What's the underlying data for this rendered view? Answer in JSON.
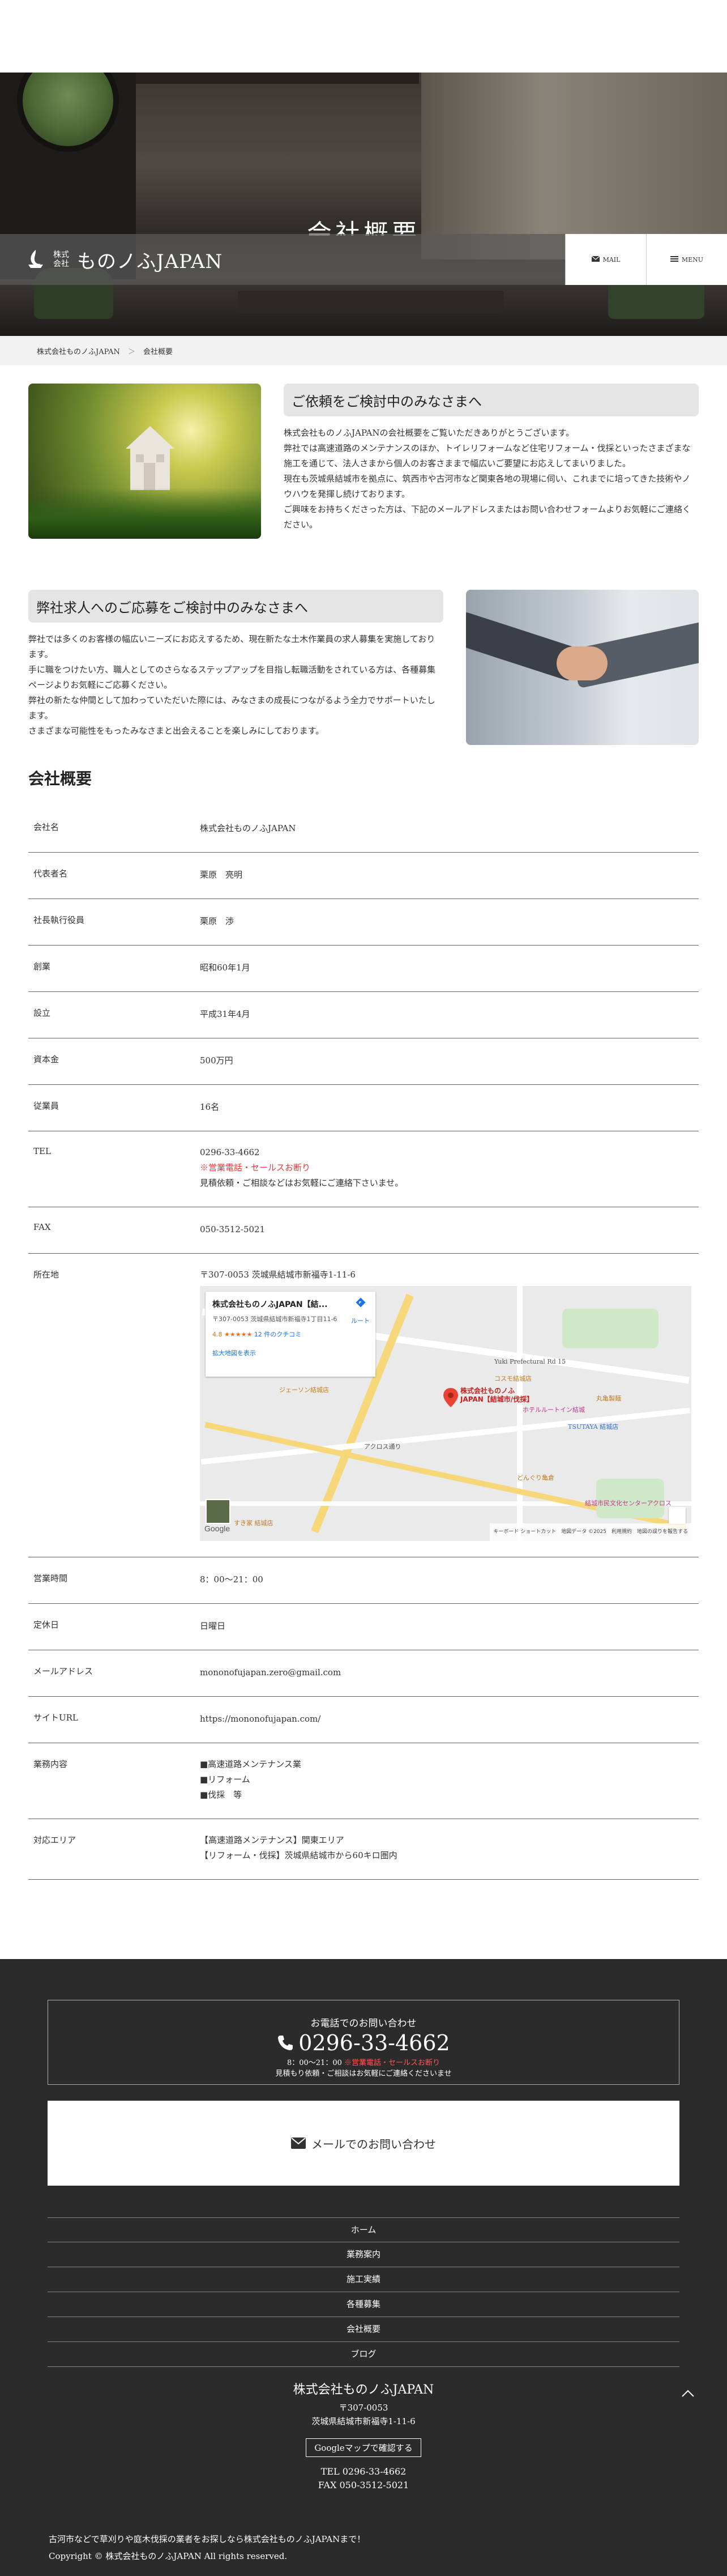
{
  "hero": {
    "title": "会社概要"
  },
  "header": {
    "logo_sub_1": "株式",
    "logo_sub_2": "会社",
    "logo_name": "ものノふJAPAN",
    "mail_label": "MAIL",
    "menu_label": "MENU"
  },
  "breadcrumb": {
    "home": "株式会社ものノふJAPAN",
    "sep": "＞",
    "current": "会社概要"
  },
  "intro1": {
    "title": "ご依頼をご検討中のみなさまへ",
    "lines": [
      "株式会社ものノふJAPANの会社概要をご覧いただきありがとうございます。",
      "弊社では高速道路のメンテナンスのほか、トイレリフォームなど住宅リフォーム・伐採といったさまざまな施工を通じて、法人さまから個人のお客さままで幅広いご要望にお応えしてまいりました。",
      "現在も茨城県結城市を拠点に、筑西市や古河市など関東各地の現場に伺い、これまでに培ってきた技術やノウハウを発揮し続けております。",
      "ご興味をお持ちくださった方は、下記のメールアドレスまたはお問い合わせフォームよりお気軽にご連絡ください。"
    ]
  },
  "intro2": {
    "title": "弊社求人へのご応募をご検討中のみなさまへ",
    "lines": [
      "弊社では多くのお客様の幅広いニーズにお応えするため、現在新たな土木作業員の求人募集を実施しております。",
      "手に職をつけたい方、職人としてのさらなるステップアップを目指し転職活動をされている方は、各種募集ページよりお気軽にご応募ください。",
      "弊社の新たな仲間として加わっていただいた際には、みなさまの成長につながるよう全力でサポートいたします。",
      "さまざまな可能性をもったみなさまと出会えることを楽しみにしております。"
    ]
  },
  "outline": {
    "title": "会社概要",
    "company_label": "会社名",
    "company_value": "株式会社ものノふJAPAN",
    "rep_label": "代表者名",
    "rep_value": "栗原　亮明",
    "exec_label": "社長執行役員",
    "exec_value": "栗原　渉",
    "founded_label": "創業",
    "founded_value": "昭和60年1月",
    "established_label": "設立",
    "established_value": "平成31年4月",
    "capital_label": "資本金",
    "capital_value": "500万円",
    "employees_label": "従業員",
    "employees_value": "16名",
    "tel_label": "TEL",
    "tel_value": "0296-33-4662",
    "tel_note_red": "※営業電話・セールスお断り",
    "tel_note": "見積依頼・ご相談などはお気軽にご連絡下さいませ。",
    "fax_label": "FAX",
    "fax_value": "050-3512-5021",
    "address_label": "所在地",
    "address_value": "〒307-0053 茨城県結城市新福寺1-11-6",
    "hours_label": "営業時間",
    "hours_value": "8：00〜21：00",
    "holiday_label": "定休日",
    "holiday_value": "日曜日",
    "email_label": "メールアドレス",
    "email_value": "mononofujapan.zero@gmail.com",
    "site_label": "サイトURL",
    "site_value": "https://mononofujapan.com/",
    "business_label": "業務内容",
    "business_items": [
      "■高速道路メンテナンス業",
      "■リフォーム",
      "■伐採　等"
    ],
    "area_label": "対応エリア",
    "area_items": [
      "【高速道路メンテナンス】関東エリア",
      "【リフォーム・伐採】茨城県結城市から60キロ圏内"
    ]
  },
  "map": {
    "info_title": "株式会社ものノふJAPAN【結...",
    "info_address": "〒307-0053 茨城県結城市新福寺1丁目11-6",
    "route_label": "ルート",
    "rating": "4.8",
    "stars": "★★★★★",
    "reviews": "12 件のクチコミ",
    "enlarge": "拡大地図を表示",
    "pin_label_1": "株式会社ものノふ",
    "pin_label_2": "JAPAN【結城市/伐採】",
    "poi_1": "コスモ結城店",
    "poi_2": "ジェーソン結城店",
    "poi_3": "TSUTAYA 結城店",
    "poi_4": "ホテルルートイン結城",
    "poi_5": "どんぐり亀倉",
    "poi_6": "結城市民文化センターアクロス",
    "poi_7": "すき家 結城店",
    "poi_8": "丸亀製麺",
    "road_1": "アクロス通り",
    "road_2": "Yuki Prefectural Rd 15",
    "google": "Google",
    "footer": "キーボード ショートカット　地図データ ©2025　利用規約　地図の誤りを報告する"
  },
  "footer": {
    "tel_label": "お電話でのお問い合わせ",
    "tel_number": "0296-33-4662",
    "tel_hours": "8：00〜21：00",
    "tel_hours_red": "※営業電話・セールスお断り",
    "tel_note": "見積もり依頼・ご相談はお気軽にご連絡くださいませ",
    "mail_label": "メールでのお問い合わせ",
    "nav": [
      "ホーム",
      "業務案内",
      "施工実績",
      "各種募集",
      "会社概要",
      "ブログ"
    ],
    "company_name": "株式会社ものノふJAPAN",
    "postal": "〒307-0053",
    "address": "茨城県結城市新福寺1-11-6",
    "map_button": "Googleマップで確認する",
    "tel": "TEL 0296-33-4662",
    "fax": "FAX 050-3512-5021",
    "tagline": "古河市などで草刈りや庭木伐採の業者をお探しなら株式会社ものノふJAPANまで！",
    "copyright": "Copyright © 株式会社ものノふJAPAN All rights reserved."
  },
  "colors": {
    "accent_red": "#e23b3b",
    "footer_bg": "#2b2b2b"
  }
}
